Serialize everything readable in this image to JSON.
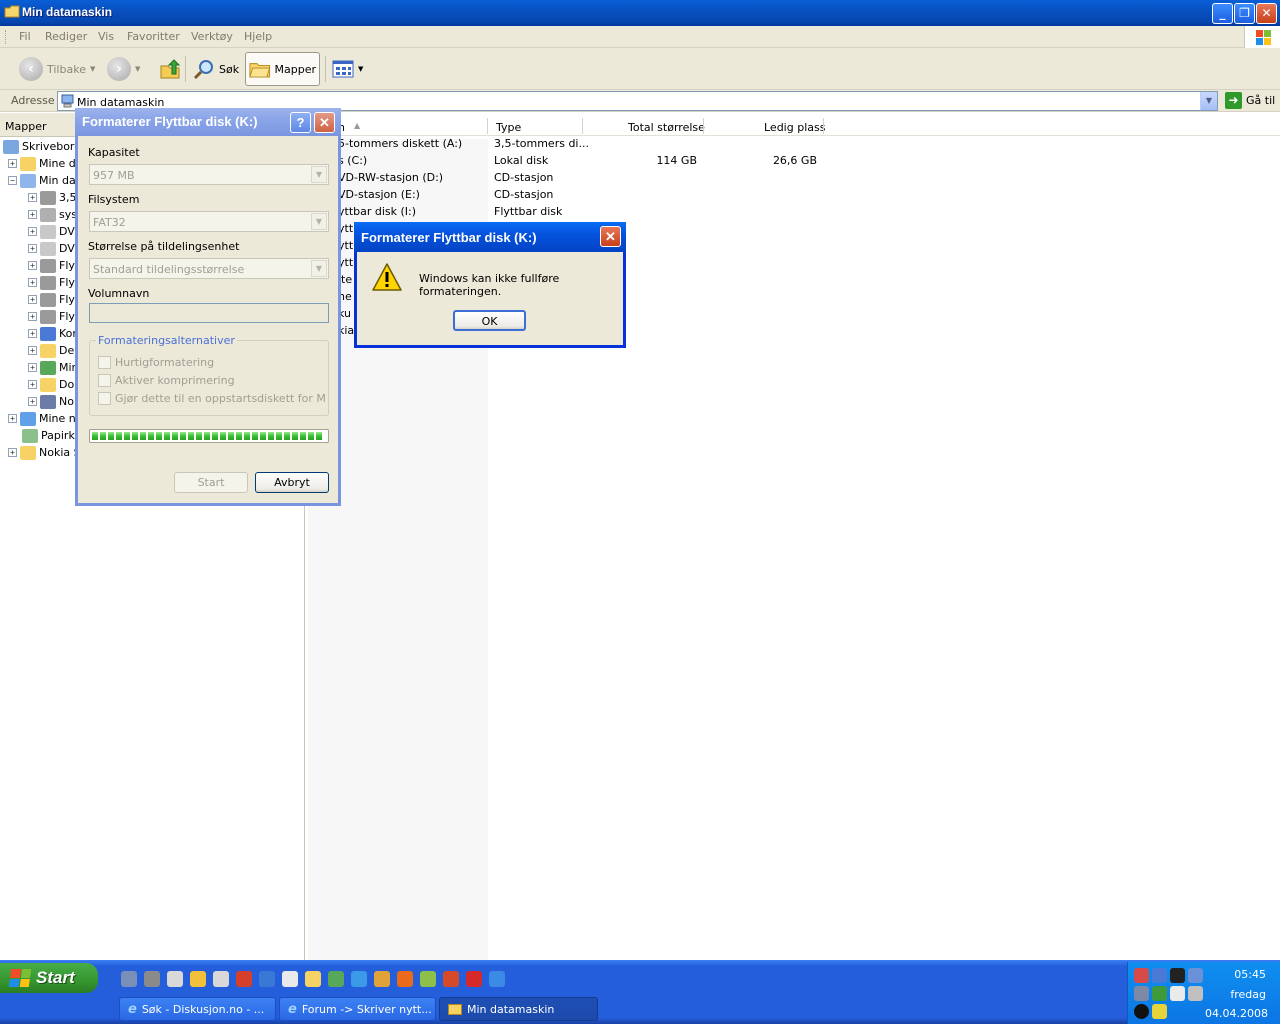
{
  "window": {
    "title": "Min datamaskin"
  },
  "menu": [
    "Fil",
    "Rediger",
    "Vis",
    "Favoritter",
    "Verktøy",
    "Hjelp"
  ],
  "toolbar": {
    "back": "Tilbake",
    "search": "Søk",
    "folders": "Mapper"
  },
  "address": {
    "label": "Adresse",
    "value": "Min datamaskin",
    "go": "Gå til"
  },
  "folders": {
    "header": "Mapper",
    "tree": [
      "Skrivebord",
      "Mine de",
      "Min dat",
      "3,5",
      "sys",
      "DV",
      "DV",
      "Fly",
      "Fly",
      "Fly",
      "Fly",
      "Kor",
      "De",
      "Mir",
      "Do",
      "No",
      "Mine ne",
      "Papirku",
      "Nokia S"
    ]
  },
  "filelist": {
    "columns": {
      "name": "n",
      "type": "Type",
      "total": "Total størrelse",
      "free": "Ledig plass"
    },
    "rows": [
      {
        "name": "5-tommers diskett (A:)",
        "type": "3,5-tommers di...",
        "total": "",
        "free": ""
      },
      {
        "name": "s (C:)",
        "type": "Lokal disk",
        "total": "114 GB",
        "free": "26,6 GB"
      },
      {
        "name": "VD-RW-stasjon (D:)",
        "type": "CD-stasjon",
        "total": "",
        "free": ""
      },
      {
        "name": "VD-stasjon (E:)",
        "type": "CD-stasjon",
        "total": "",
        "free": ""
      },
      {
        "name": "yttbar disk (I:)",
        "type": "Flyttbar disk",
        "total": "",
        "free": ""
      }
    ],
    "partial": [
      "ytt",
      "ytt",
      "ytt",
      "lte",
      "ne",
      "ku",
      "kia"
    ]
  },
  "format_dialog": {
    "title": "Formaterer Flyttbar disk (K:)",
    "capacity_label": "Kapasitet",
    "capacity_value": "957 MB",
    "fs_label": "Filsystem",
    "fs_value": "FAT32",
    "alloc_label": "Størrelse på tildelingsenhet",
    "alloc_value": "Standard tildelingsstørrelse",
    "volume_label": "Volumnavn",
    "volume_value": "",
    "options_label": "Formateringsalternativer",
    "options": [
      "Hurtigformatering",
      "Aktiver komprimering",
      "Gjør dette til en oppstartsdiskett for MS-DOS"
    ],
    "progress": 1.0,
    "start": "Start",
    "cancel": "Avbryt"
  },
  "error_dialog": {
    "title": "Formaterer Flyttbar disk (K:)",
    "message": "Windows kan ikke fullføre formateringen.",
    "ok": "OK"
  },
  "taskbar": {
    "start": "Start",
    "tasks": [
      "Søk - Diskusjon.no - ...",
      "Forum -> Skriver nytt...",
      "Min datamaskin"
    ],
    "clock": {
      "time": "05:45",
      "day": "fredag",
      "date": "04.04.2008"
    }
  }
}
